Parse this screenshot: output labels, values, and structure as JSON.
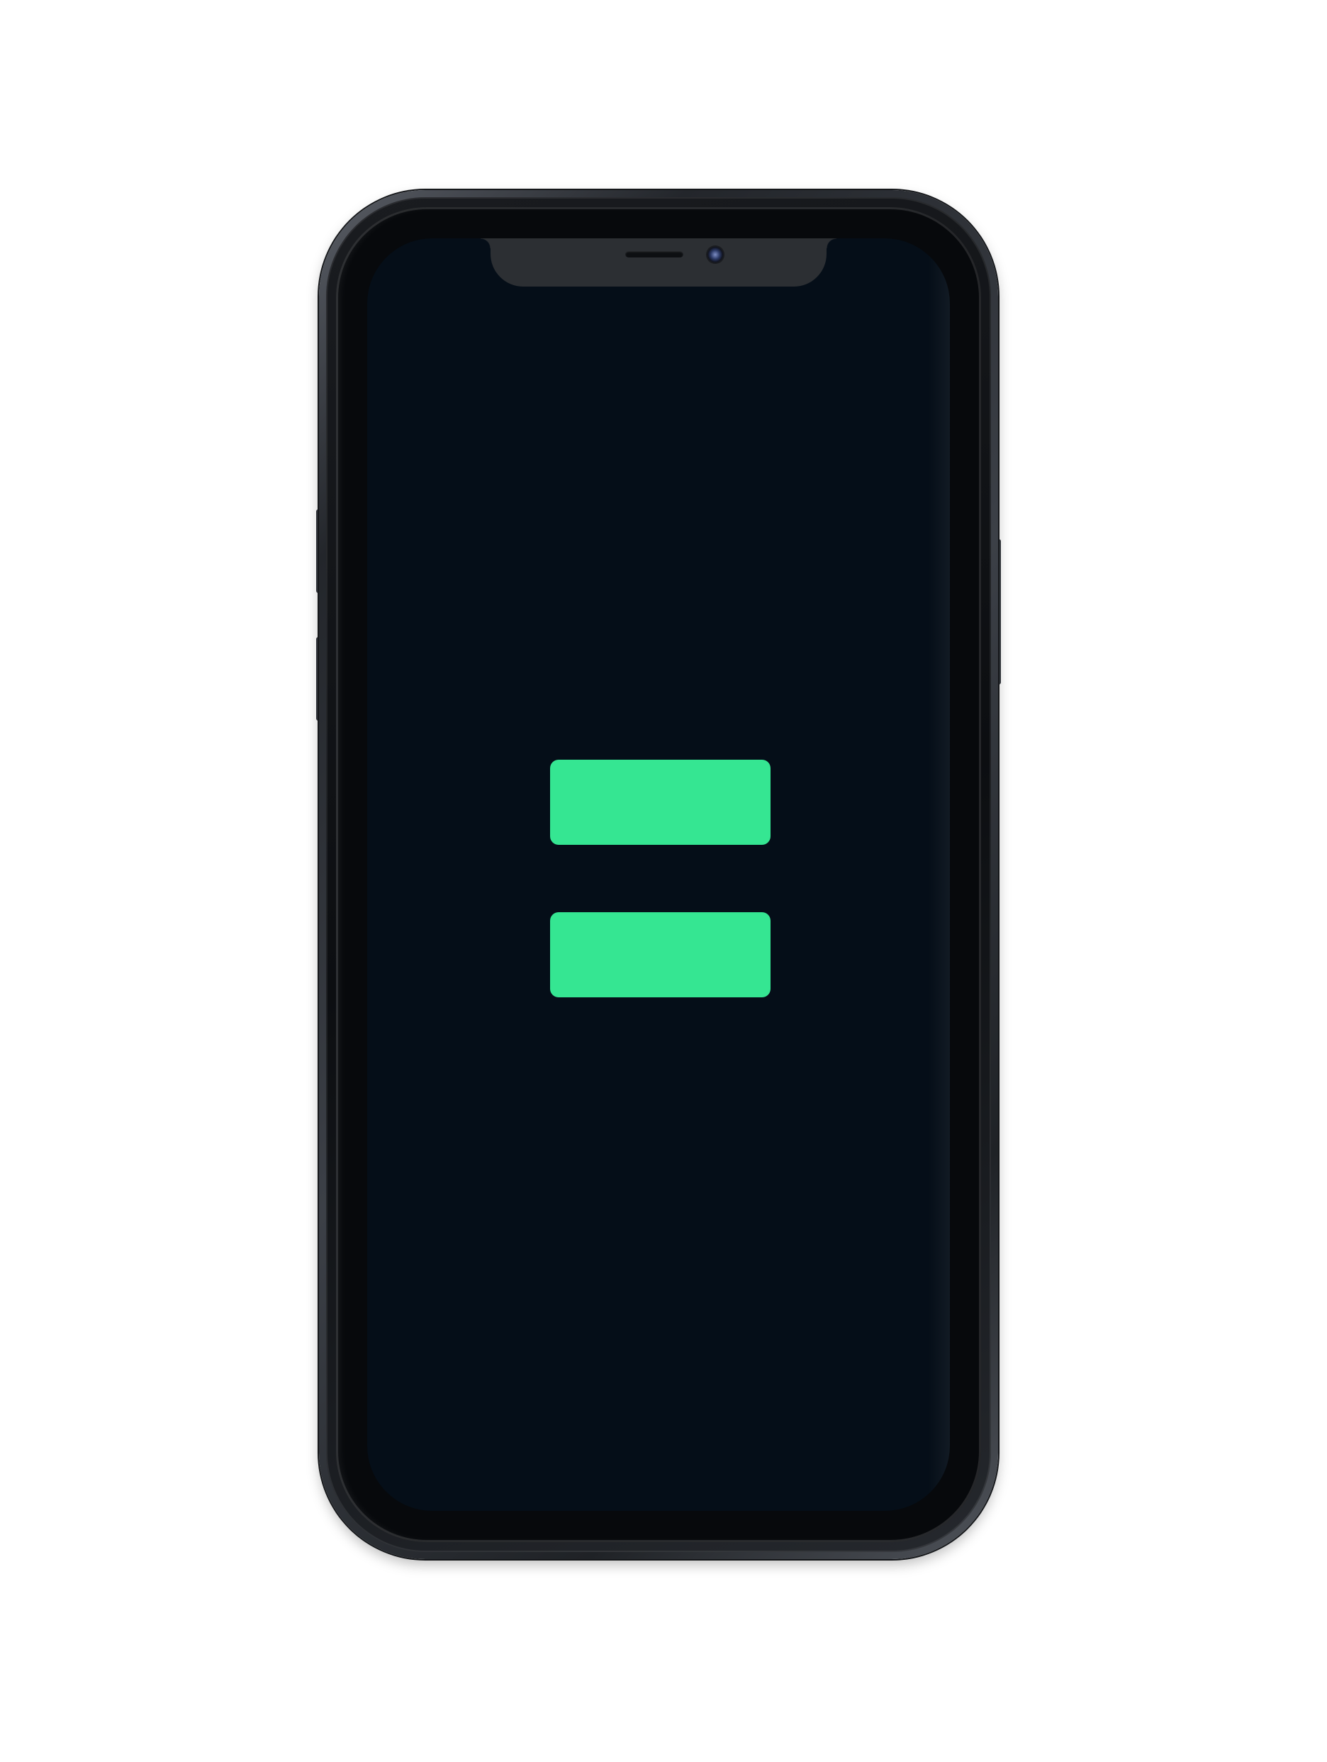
{
  "colors": {
    "background": "#ffffff",
    "screen": "#050e18",
    "accent": "#35e692",
    "frame": "#2a2d33"
  },
  "device": {
    "model_shape": "notched-phone",
    "earpiece_icon": "speaker-grille",
    "camera_icon": "front-camera"
  },
  "screen": {
    "buttons": [
      {
        "label": ""
      },
      {
        "label": ""
      }
    ]
  }
}
